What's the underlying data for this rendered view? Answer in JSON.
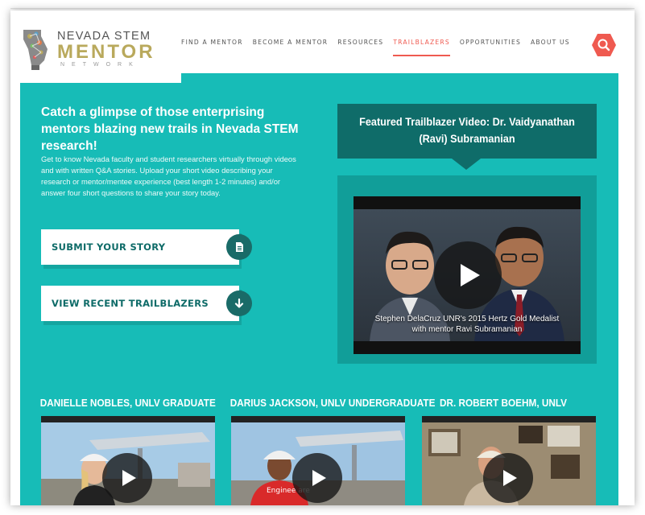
{
  "logo": {
    "line1": "NEVADA STEM",
    "line2": "MENTOR",
    "line3": "NETWORK"
  },
  "nav": {
    "items": [
      {
        "label": "FIND A MENTOR"
      },
      {
        "label": "BECOME A MENTOR"
      },
      {
        "label": "RESOURCES"
      },
      {
        "label": "TRAILBLAZERS",
        "active": true
      },
      {
        "label": "OPPORTUNITIES"
      },
      {
        "label": "ABOUT US"
      }
    ]
  },
  "hero": {
    "headline": "Catch a glimpse of those enterprising mentors blazing new trails in Nevada STEM research!",
    "intro": "Get to know Nevada faculty and student researchers virtually through videos and with written Q&A stories.  Upload your short video describing your research or mentor/mentee experience (best length 1-2 minutes) and/or answer four short questions to share your story today."
  },
  "buttons": {
    "submit_label": "SUBMIT YOUR STORY",
    "view_label": "VIEW RECENT TRAILBLAZERS"
  },
  "featured": {
    "title": "Featured Trailblazer Video: Dr. Vaidyanathan (Ravi) Subramanian",
    "caption_line1": "Stephen DelaCruz UNR's 2015 Hertz Gold Medalist",
    "caption_line2": "with mentor Ravi Subramanian"
  },
  "videos": [
    {
      "title": "DANIELLE NOBLES, UNLV GRADUATE"
    },
    {
      "title": "DARIUS JACKSON, UNLV UNDERGRADUATE",
      "shirt_text": "Enginee are"
    },
    {
      "title": "DR. ROBERT BOEHM, UNLV"
    }
  ],
  "colors": {
    "teal": "#17bcb7",
    "dark_teal": "#0f6c69",
    "accent": "#ef5a50",
    "gold": "#b9a95c"
  },
  "icons": {
    "search": "search-icon",
    "submit": "document-icon",
    "view": "arrow-down-icon",
    "play": "play-icon"
  }
}
